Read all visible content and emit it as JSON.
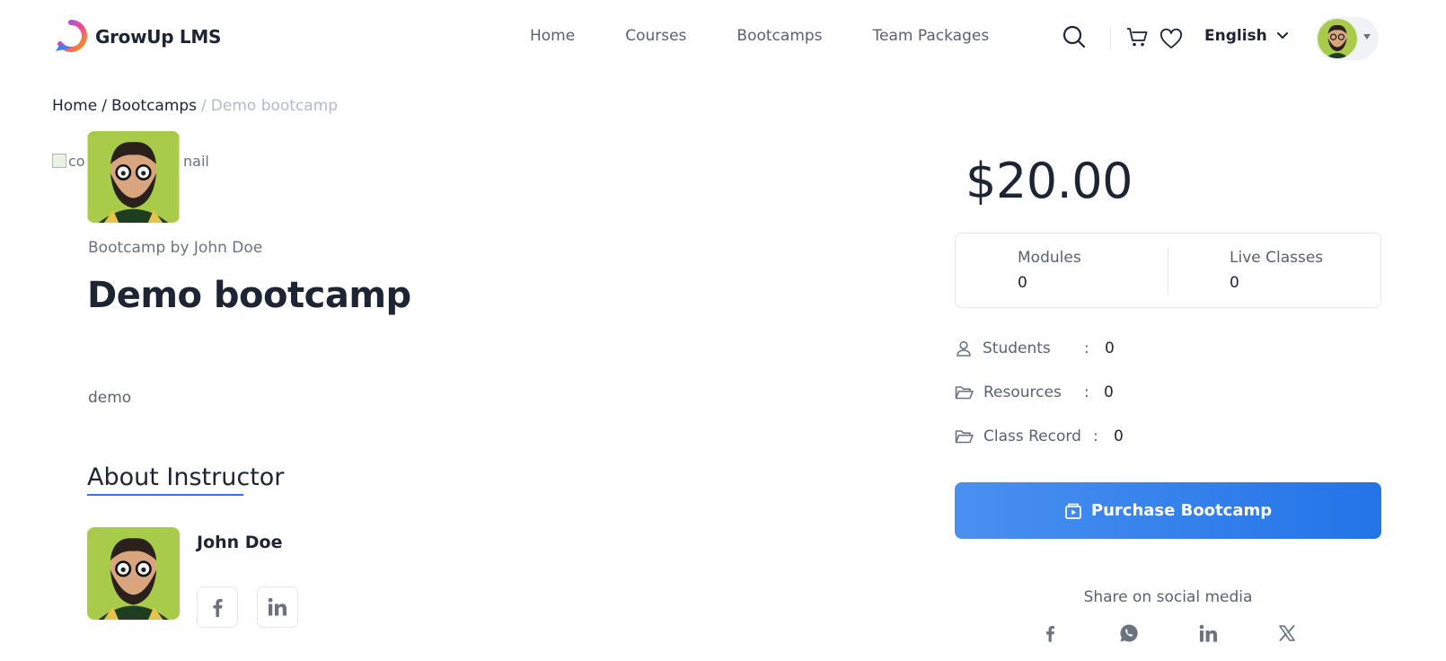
{
  "header": {
    "brand": "GrowUp LMS",
    "nav": [
      "Home",
      "Courses",
      "Bootcamps",
      "Team Packages"
    ],
    "language": "English",
    "icons": [
      "search-icon",
      "cart-icon",
      "heart-icon",
      "chevron-down-icon"
    ]
  },
  "breadcrumb": {
    "home": "Home",
    "section": "Bootcamps",
    "current": "Demo bootcamp"
  },
  "bootcamp": {
    "thumbnail_alt_start": "co",
    "thumbnail_alt_end": "nail",
    "byline": "Bootcamp by John Doe",
    "title": "Demo bootcamp",
    "description": "demo"
  },
  "instructor": {
    "heading": "About Instructor",
    "name": "John Doe",
    "socials": [
      "facebook-icon",
      "linkedin-icon"
    ]
  },
  "sidebar": {
    "price": "$20.00",
    "modules_label": "Modules",
    "modules_value": "0",
    "live_label": "Live Classes",
    "live_value": "0",
    "meta": [
      {
        "label": "Students",
        "value": "0"
      },
      {
        "label": "Resources",
        "value": "0"
      },
      {
        "label": "Class Record",
        "value": "0"
      }
    ],
    "purchase_label": "Purchase Bootcamp",
    "share_label": "Share on social media",
    "share_icons": [
      "facebook-icon",
      "whatsapp-icon",
      "linkedin-icon",
      "x-icon"
    ]
  },
  "colors": {
    "accent": "#2374e8",
    "text": "#1d2433",
    "muted": "#5a6170"
  }
}
